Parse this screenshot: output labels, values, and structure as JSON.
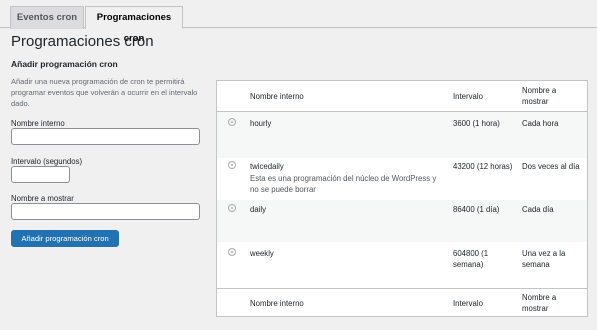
{
  "tabs": [
    "Eventos cron",
    "Programaciones cron"
  ],
  "page_title": "Programaciones cron",
  "form": {
    "section_title": "Añadir programación cron",
    "description": "Añadir una nueva programación de cron te permitirá programar eventos que volverán a ocurrir en el intervalo dado.",
    "name_label": "Nombre interno",
    "interval_label": "Intervalo (segundos)",
    "display_label": "Nombre a mostrar",
    "submit_label": "Añadir programación cron"
  },
  "table": {
    "headers": [
      "Nombre interno",
      "Intervalo",
      "Nombre a mostrar"
    ],
    "rows": [
      {
        "name": "hourly",
        "note": "",
        "interval": "3600 (1 hora)",
        "display": "Cada hora"
      },
      {
        "name": "twicedaily",
        "note": "Esta es una programación del núcleo de WordPress y no se puede borrar",
        "interval": "43200 (12 horas)",
        "display": "Dos veces al día"
      },
      {
        "name": "daily",
        "note": "",
        "interval": "86400 (1 día)",
        "display": "Cada día"
      },
      {
        "name": "weekly",
        "note": "",
        "interval": "604800 (1 semana)",
        "display": "Una vez a la semana"
      }
    ],
    "footers": [
      "Nombre interno",
      "Intervalo",
      "Nombre a mostrar"
    ]
  },
  "colors": {
    "primary": "#2271b1",
    "background": "#f0f0f1",
    "alt_row": "#f6f7f7"
  }
}
